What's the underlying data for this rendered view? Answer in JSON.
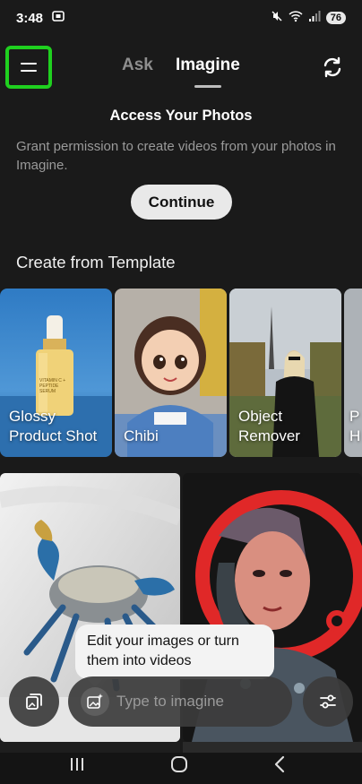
{
  "status": {
    "time": "3:48",
    "battery": "76"
  },
  "nav": {
    "tabs": [
      {
        "label": "Ask"
      },
      {
        "label": "Imagine"
      }
    ]
  },
  "permission": {
    "title": "Access Your Photos",
    "description": "Grant permission to create videos from your photos in Imagine.",
    "button": "Continue"
  },
  "templates": {
    "title": "Create from Template",
    "items": [
      {
        "label": "Glossy\nProduct Shot"
      },
      {
        "label": "Chibi"
      },
      {
        "label": "Object\nRemover"
      },
      {
        "label": "P\nH"
      }
    ]
  },
  "product": {
    "bottle_text": "VITAMIN C + PEPTIDE SERUM"
  },
  "tooltip": {
    "text": "Edit your images or turn them into videos"
  },
  "composer": {
    "placeholder": "Type to imagine"
  },
  "colors": {
    "highlight": "#1fd01f",
    "background": "#1a1a1a"
  }
}
